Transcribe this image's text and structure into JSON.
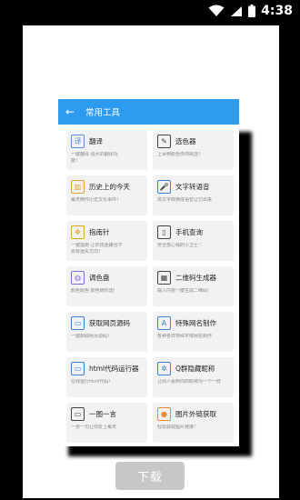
{
  "status": {
    "time": "4:38"
  },
  "app": {
    "title": "常用工具",
    "tiles": [
      {
        "title": "翻译",
        "desc1": "一键翻译 强大的翻译功",
        "desc2": "能！",
        "icon": "translate-icon",
        "glyph": "译",
        "color": "#5b8dd6"
      },
      {
        "title": "选色器",
        "desc1": "上百种颜色供你挑选！",
        "desc2": "",
        "icon": "color-picker-icon",
        "glyph": "✎",
        "color": "#444444"
      },
      {
        "title": "历史上的今天",
        "desc1": "每天两件历史文化事件！",
        "desc2": "",
        "icon": "history-book-icon",
        "glyph": "▥",
        "color": "#e0a52c"
      },
      {
        "title": "文字转语音",
        "desc1": "将文字转换成语音让它出来",
        "desc2": "",
        "icon": "microphone-icon",
        "glyph": "🎤",
        "color": "#3a82d8"
      },
      {
        "title": "指南针",
        "desc1": "一键指南 让你再迷路也不",
        "desc2": "会有迷失方向！",
        "icon": "compass-icon",
        "glyph": "✥",
        "color": "#e0a52c"
      },
      {
        "title": "手机查询",
        "desc1": "安全放心我的小卫士♡",
        "desc2": "",
        "icon": "phone-icon",
        "glyph": "▯",
        "color": "#444444"
      },
      {
        "title": "调色盘",
        "desc1": "颜色配色 颜色随你选!",
        "desc2": "",
        "icon": "palette-icon",
        "glyph": "◍",
        "color": "#8a6bd8"
      },
      {
        "title": "二维码生成器",
        "desc1": "输入内容一键生成二维码!",
        "desc2": "",
        "icon": "qrcode-icon",
        "glyph": "▦",
        "color": "#444444"
      },
      {
        "title": "获取网页源码",
        "desc1": "一键获取网页源码！",
        "desc2": "",
        "icon": "monitor-icon",
        "glyph": "▭",
        "color": "#3a82d8"
      },
      {
        "title": "特殊网名制作",
        "desc1": "各种各样特殊字体网名制作",
        "desc2": "",
        "icon": "special-font-icon",
        "glyph": "A",
        "color": "#3a82d8"
      },
      {
        "title": "html代码运行器",
        "desc1": "在线运行html代码！",
        "desc2": "",
        "icon": "code-runner-icon",
        "glyph": "▭",
        "color": "#3a82d8"
      },
      {
        "title": "Q群隐藏昵称",
        "desc1": "让别人看到你的昵称为一个一样",
        "desc2": "",
        "icon": "hide-nickname-icon",
        "glyph": "✲",
        "color": "#3a82d8"
      },
      {
        "title": "一图一言",
        "desc1": "一张一句让你爱上每天",
        "desc2": "",
        "icon": "image-quote-icon",
        "glyph": "▭",
        "color": "#444444"
      },
      {
        "title": "图片外链获取",
        "desc1": "轻松获取图片链接！",
        "desc2": "",
        "icon": "image-link-icon",
        "glyph": "●",
        "color": "#f08a2c"
      }
    ]
  },
  "download_label": "下载"
}
